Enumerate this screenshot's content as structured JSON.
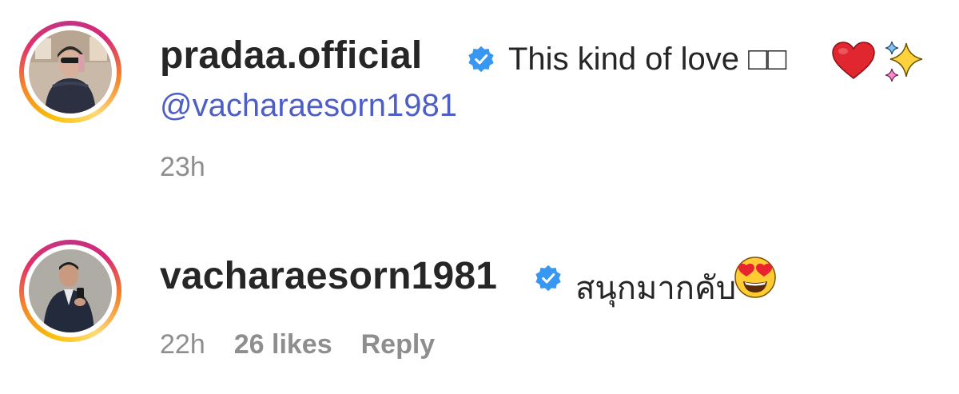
{
  "comments": [
    {
      "username": "pradaa.official",
      "text": "This kind of love □□",
      "mention": "@vacharaesorn1981",
      "time": "23h",
      "emojis": [
        "red-heart",
        "sparkles"
      ],
      "verified": true
    },
    {
      "username": "vacharaesorn1981",
      "text": "สนุกมากคับ",
      "time": "22h",
      "likes": "26 likes",
      "reply": "Reply",
      "emojis": [
        "heart-eyes-face"
      ],
      "verified": true
    }
  ],
  "colors": {
    "verified_blue": "#3897f0",
    "mention_blue": "#4d5ec6",
    "meta_gray": "#8e8e8e",
    "text_dark": "#262626"
  }
}
